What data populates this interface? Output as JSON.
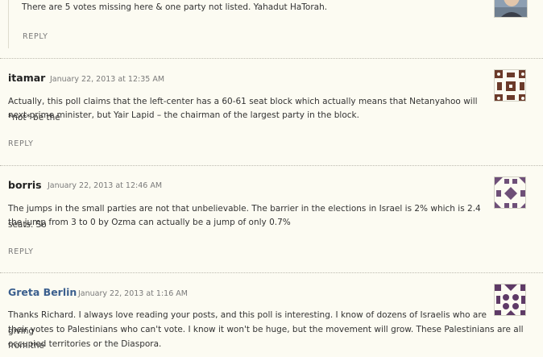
{
  "comments": [
    {
      "author": "",
      "date": "",
      "text": "There are 5 votes missing here & one party not listed. Yahadut HaTorah.",
      "reply": "REPLY",
      "avatar_icon": "photo-avatar-icon"
    },
    {
      "author": "itamar",
      "date": "January 22, 2013 at 12:35 AM",
      "text_lines": [
        "Actually, this poll claims that the left-center has a 60-61 seat block which actually means that Netanyahoo will *not* be the",
        "next prime minister, but Yair Lapid – the chairman of the largest party in the block."
      ],
      "reply": "REPLY",
      "avatar_icon": "identicon-brown-icon",
      "avatar_color": "#6b3a2a"
    },
    {
      "author": "borris",
      "date": "January 22, 2013 at 12:46 AM",
      "text_lines": [
        "The jumps in the small parties are not that unbelievable. The barrier in the elections in Israel is 2% which is 2.4 seats. So",
        "the jump from 3 to 0 by Ozma can actually be a jump of only 0.7%"
      ],
      "reply": "REPLY",
      "avatar_icon": "identicon-purple-icon",
      "avatar_color": "#6e4f78"
    },
    {
      "author": "Greta Berlin",
      "date": "January 22, 2013 at 1:16 AM",
      "text_lines": [
        "Thanks Richard. I always love reading your posts, and this poll is interesting. I know of dozens of Israelis who are giving",
        "their votes to Palestinians who can't vote. I know it won't be huge, but the movement will grow. These Palestinians are all from the",
        "occupied territories or the Diaspora."
      ],
      "avatar_icon": "identicon-plum-icon",
      "avatar_color": "#5e3a66"
    }
  ],
  "colors": {
    "background": "#fcfbf2",
    "author_link": "#3b5f8e",
    "meta_gray": "#7a7a7a"
  }
}
